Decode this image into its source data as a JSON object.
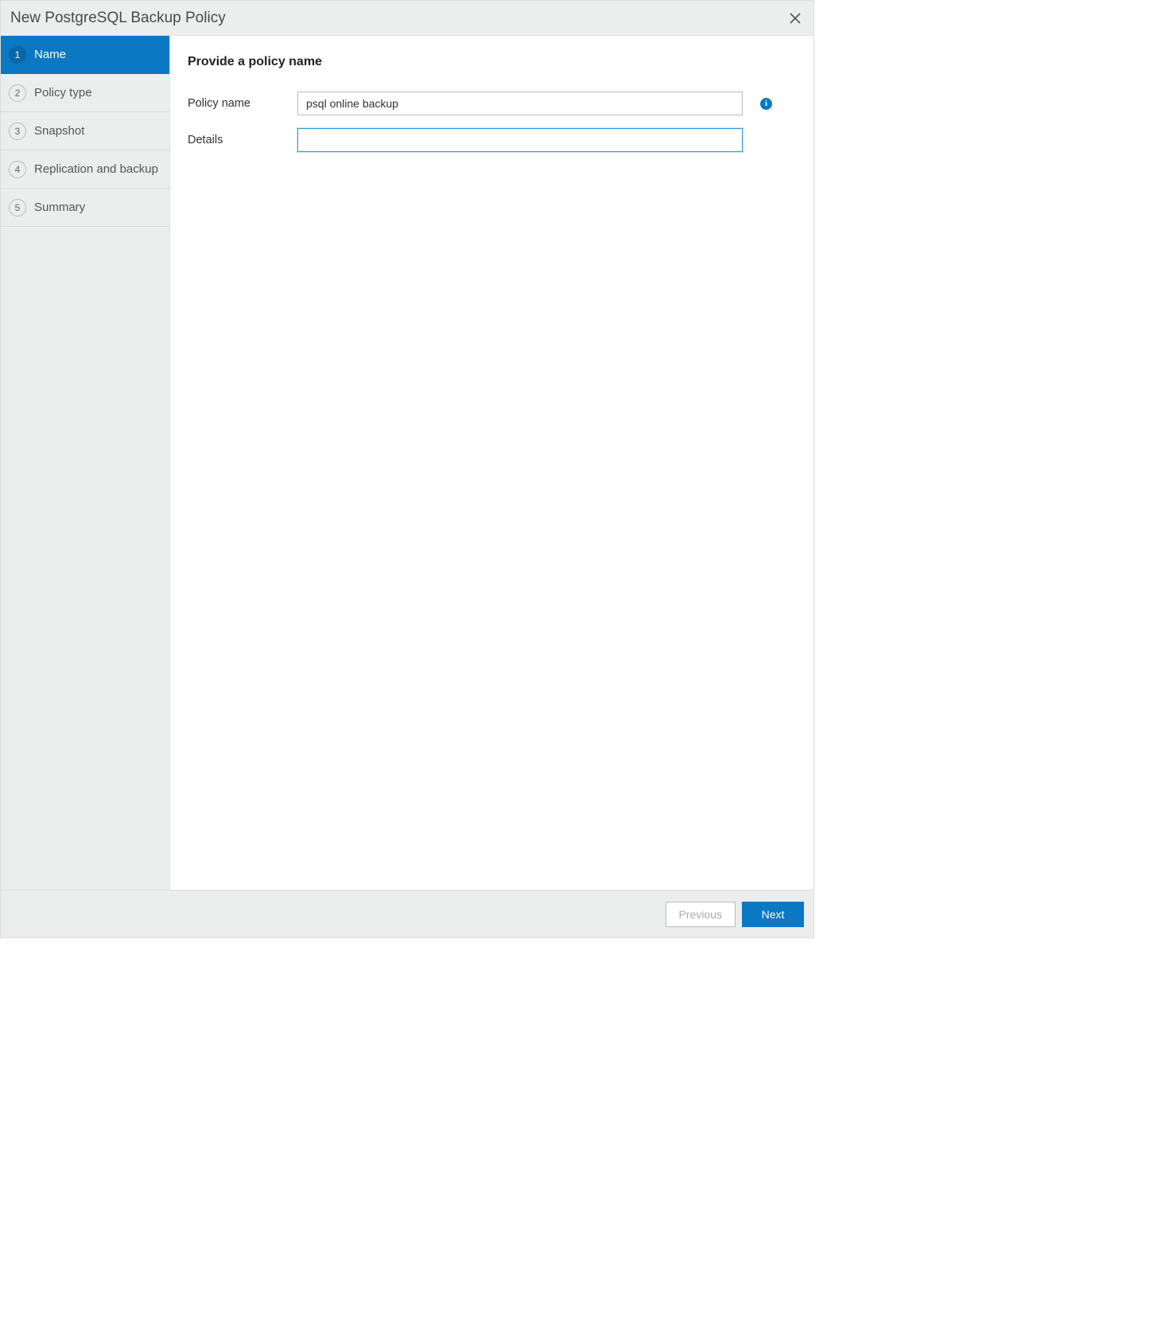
{
  "dialog": {
    "title": "New PostgreSQL Backup Policy"
  },
  "sidebar": {
    "steps": [
      {
        "num": "1",
        "label": "Name"
      },
      {
        "num": "2",
        "label": "Policy type"
      },
      {
        "num": "3",
        "label": "Snapshot"
      },
      {
        "num": "4",
        "label": "Replication and backup"
      },
      {
        "num": "5",
        "label": "Summary"
      }
    ]
  },
  "main": {
    "heading": "Provide a policy name",
    "policy_name_label": "Policy name",
    "policy_name_value": "psql online backup",
    "details_label": "Details",
    "details_value": ""
  },
  "footer": {
    "previous": "Previous",
    "next": "Next"
  }
}
